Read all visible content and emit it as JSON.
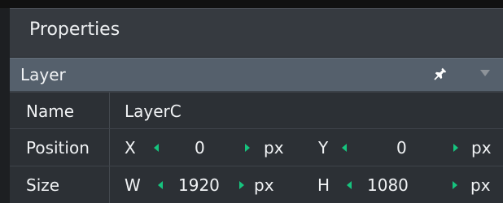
{
  "panel": {
    "title": "Properties"
  },
  "section": {
    "title": "Layer",
    "pin_icon": "pin-icon",
    "dropdown_icon": "chevron-down-icon"
  },
  "rows": {
    "name": {
      "label": "Name",
      "value": "LayerC"
    },
    "position": {
      "label": "Position",
      "x_label": "X",
      "x_value": "0",
      "x_unit": "px",
      "y_label": "Y",
      "y_value": "0",
      "y_unit": "px"
    },
    "size": {
      "label": "Size",
      "w_label": "W",
      "w_value": "1920",
      "w_unit": "px",
      "h_label": "H",
      "h_value": "1080",
      "h_unit": "px"
    }
  },
  "colors": {
    "accent_arrow": "#16c47e"
  }
}
